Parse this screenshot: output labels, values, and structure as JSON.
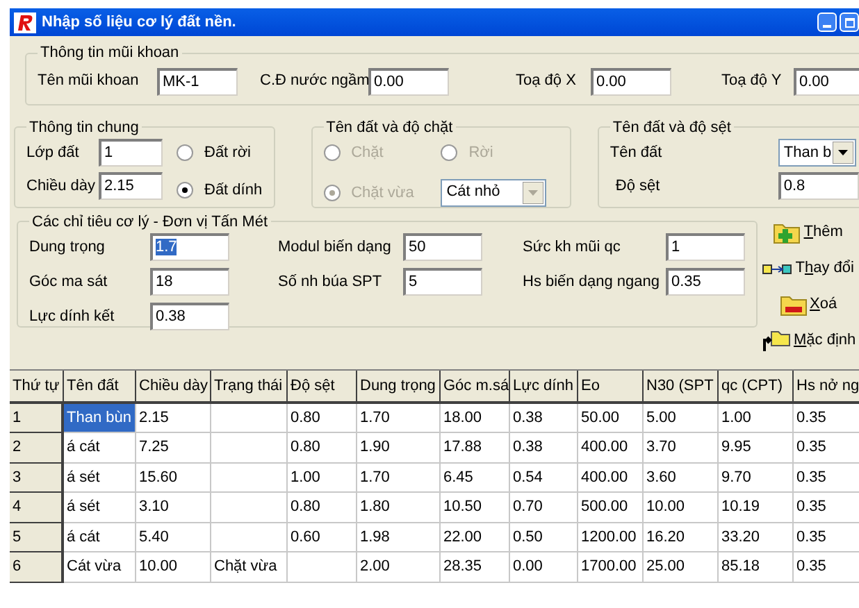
{
  "window": {
    "title": "Nhập số liệu cơ lý đất nền."
  },
  "borehole": {
    "title": "Thông tin mũi khoan",
    "fields": [
      {
        "label": "Tên mũi khoan",
        "value": "MK-1"
      },
      {
        "label": "C.Đ nước ngầm",
        "value": "0.00"
      },
      {
        "label": "Toạ độ X",
        "value": "0.00"
      },
      {
        "label": "Toạ độ Y",
        "value": "0.00"
      }
    ]
  },
  "general": {
    "title": "Thông tin chung",
    "fields": [
      {
        "label": "Lớp đất",
        "value": "1"
      },
      {
        "label": "Chiều dày",
        "value": "2.15"
      }
    ],
    "radios": [
      {
        "label": "Đất rời",
        "selected": false
      },
      {
        "label": "Đất dính",
        "selected": true
      }
    ]
  },
  "density": {
    "title": "Tên đất và độ chặt",
    "disabled": true,
    "radios": [
      {
        "label": "Chặt",
        "selected": false
      },
      {
        "label": "Rời",
        "selected": false
      },
      {
        "label": "Chặt vừa",
        "selected": true
      }
    ],
    "dropdown": {
      "value": "Cát nhỏ"
    }
  },
  "consistency": {
    "title": "Tên đất và độ sệt",
    "soil_label": "Tên đất",
    "dropdown": {
      "value": "Than b"
    },
    "field": {
      "label": "Độ sệt",
      "value": "0.8"
    }
  },
  "indices": {
    "title": "Các chỉ tiêu cơ lý - Đơn vị Tấn Mét",
    "fields": [
      {
        "label": "Dung trọng",
        "value": "1.7",
        "selected": true
      },
      {
        "label": "Modul biến dạng",
        "value": "50",
        "selected": false
      },
      {
        "label": "Sức kh mũi qc",
        "value": "1",
        "selected": false
      },
      {
        "label": "Góc ma sát",
        "value": "18",
        "selected": false
      },
      {
        "label": "Số nh búa SPT",
        "value": "5",
        "selected": false
      },
      {
        "label": "Hs biến dạng ngang",
        "value": "0.35",
        "selected": false
      },
      {
        "label": "Lực dính kết",
        "value": "0.38",
        "selected": false
      }
    ]
  },
  "actions": [
    {
      "kind": "add",
      "hotkey": "T",
      "rest": "hêm"
    },
    {
      "kind": "change",
      "pre": "T",
      "hotkey": "h",
      "rest": "ay đổi"
    },
    {
      "kind": "delete",
      "hotkey": "X",
      "rest": "oá"
    },
    {
      "kind": "default",
      "hotkey": "M",
      "rest": "ặc định"
    }
  ],
  "table": {
    "columns": [
      "Thứ tự",
      "Tên đất",
      "Chiều dày",
      "Trạng thái",
      "Độ sệt",
      "Dung trọng",
      "Góc m.sá",
      "Lực dính",
      "Eo",
      "N30 (SPT",
      "qc (CPT)",
      "Hs nở ng"
    ],
    "rows": [
      {
        "cells": [
          "1",
          "Than bùn",
          "2.15",
          "",
          "0.80",
          "1.70",
          "18.00",
          "0.38",
          "50.00",
          "5.00",
          "1.00",
          "0.35"
        ],
        "selected": true
      },
      {
        "cells": [
          "2",
          "á cát",
          "7.25",
          "",
          "0.80",
          "1.90",
          "17.88",
          "0.38",
          "400.00",
          "3.70",
          "9.95",
          "0.35"
        ],
        "selected": false
      },
      {
        "cells": [
          "3",
          "á sét",
          "15.60",
          "",
          "1.00",
          "1.70",
          "6.45",
          "0.54",
          "400.00",
          "3.60",
          "9.70",
          "0.35"
        ],
        "selected": false
      },
      {
        "cells": [
          "4",
          "á sét",
          "3.10",
          "",
          "0.80",
          "1.80",
          "10.50",
          "0.70",
          "500.00",
          "10.00",
          "10.19",
          "0.35"
        ],
        "selected": false
      },
      {
        "cells": [
          "5",
          "á cát",
          "5.40",
          "",
          "0.60",
          "1.98",
          "22.00",
          "0.50",
          "1200.00",
          "16.20",
          "33.20",
          "0.35"
        ],
        "selected": false
      },
      {
        "cells": [
          "6",
          "Cát vừa",
          "10.00",
          "Chặt vừa",
          "",
          "2.00",
          "28.35",
          "0.00",
          "1700.00",
          "25.00",
          "85.18",
          "0.35"
        ],
        "selected": false
      }
    ]
  }
}
